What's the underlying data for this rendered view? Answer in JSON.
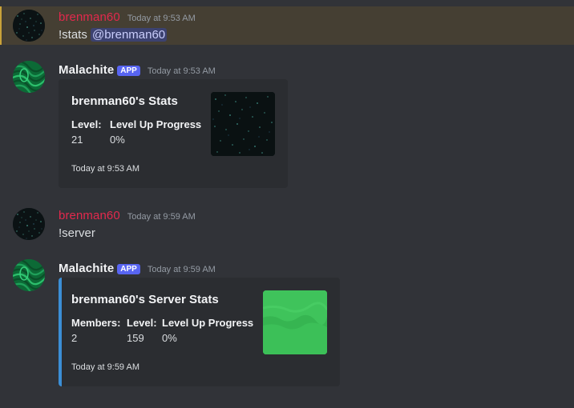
{
  "colors": {
    "background": "#313338",
    "highlight_bg": "#453f33",
    "highlight_bar": "#c9a23a",
    "user_name": "#e3294d",
    "bot_name": "#f2f3f5",
    "app_badge": "#5865f2",
    "embed_bg": "#2b2d31",
    "embed_accent": "#3b8fd6",
    "thumbnail_green": "#3fc35b"
  },
  "messages": [
    {
      "author": "brenman60",
      "avatar_icon": "starfield-avatar-icon",
      "timestamp": "Today at 9:53 AM",
      "text": "!stats",
      "mention": "@brenman60"
    },
    {
      "author": "Malachite",
      "badge": "APP",
      "avatar_icon": "malachite-avatar-icon",
      "timestamp": "Today at 9:53 AM",
      "embed": {
        "title": "brenman60's Stats",
        "fields": [
          {
            "name": "Level:",
            "value": "21"
          },
          {
            "name": "Level Up Progress",
            "value": "0%"
          }
        ],
        "footer": "Today at 9:53 AM",
        "thumbnail_icon": "starfield-thumbnail-icon"
      }
    },
    {
      "author": "brenman60",
      "avatar_icon": "starfield-avatar-icon",
      "timestamp": "Today at 9:59 AM",
      "text": "!server"
    },
    {
      "author": "Malachite",
      "badge": "APP",
      "avatar_icon": "malachite-avatar-icon",
      "timestamp": "Today at 9:59 AM",
      "embed": {
        "title": "brenman60's Server Stats",
        "fields": [
          {
            "name": "Members:",
            "value": "2"
          },
          {
            "name": "Level:",
            "value": "159"
          },
          {
            "name": "Level Up Progress",
            "value": "0%"
          }
        ],
        "footer": "Today at 9:59 AM",
        "thumbnail_icon": "green-server-icon-thumbnail"
      }
    }
  ]
}
